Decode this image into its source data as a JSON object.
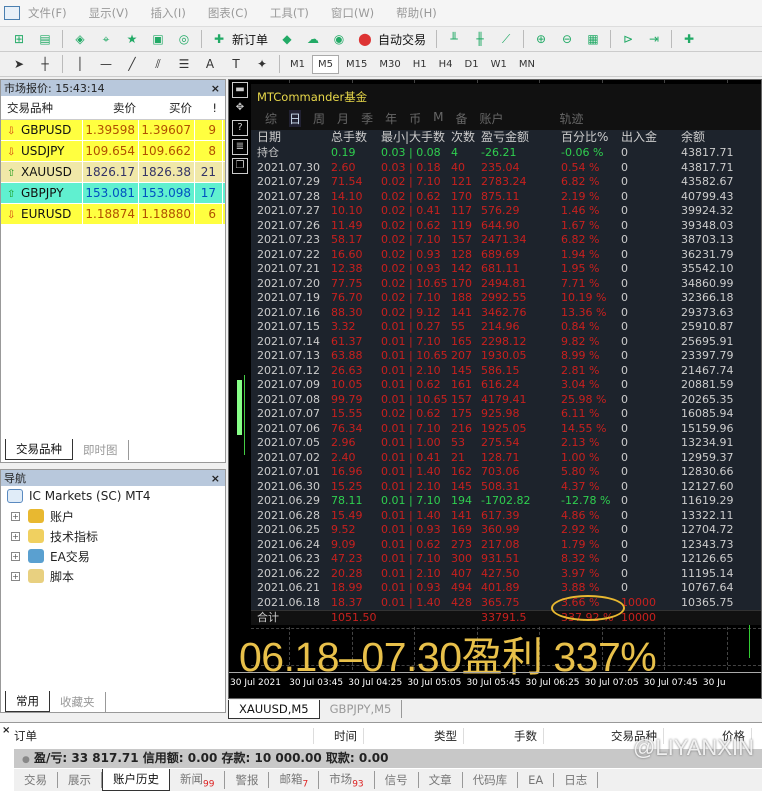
{
  "menu": [
    "文件(F)",
    "显示(V)",
    "插入(I)",
    "图表(C)",
    "工具(T)",
    "窗口(W)",
    "帮助(H)"
  ],
  "toolbar": {
    "new_order": "新订单",
    "auto_trade": "自动交易"
  },
  "timeframes": [
    "M1",
    "M5",
    "M15",
    "M30",
    "H1",
    "H4",
    "D1",
    "W1",
    "MN"
  ],
  "active_timeframe": "M5",
  "market_watch": {
    "title": "市场报价: 15:43:14",
    "headers": [
      "交易品种",
      "卖价",
      "买价",
      "!"
    ],
    "rows": [
      {
        "symbol": "GBPUSD",
        "bid": "1.39598",
        "ask": "1.39607",
        "spread": "9",
        "dir": "down",
        "bg": "#ffff40",
        "fg": "#b05000"
      },
      {
        "symbol": "USDJPY",
        "bid": "109.654",
        "ask": "109.662",
        "spread": "8",
        "dir": "down",
        "bg": "#ffff40",
        "fg": "#b05000"
      },
      {
        "symbol": "XAUUSD",
        "bid": "1826.17",
        "ask": "1826.38",
        "spread": "21",
        "dir": "up",
        "bg": "#f0e8a8",
        "fg": "#333366"
      },
      {
        "symbol": "GBPJPY",
        "bid": "153.081",
        "ask": "153.098",
        "spread": "17",
        "dir": "up",
        "bg": "#60f0d0",
        "fg": "#0050c0"
      },
      {
        "symbol": "EURUSD",
        "bid": "1.18874",
        "ask": "1.18880",
        "spread": "6",
        "dir": "down",
        "bg": "#ffff40",
        "fg": "#b05000"
      }
    ],
    "tabs": [
      "交易品种",
      "即时图"
    ]
  },
  "navigator": {
    "title": "导航",
    "root": "IC Markets (SC) MT4",
    "items": [
      "账户",
      "技术指标",
      "EA交易",
      "脚本"
    ],
    "tabs": [
      "常用",
      "收藏夹"
    ]
  },
  "commander": {
    "title": "MTCommander基金",
    "nav": [
      "综",
      "日",
      "周",
      "月",
      "季",
      "年",
      "币",
      "M",
      "备",
      "账户",
      "轨迹"
    ],
    "active": "日",
    "headers": [
      "日期",
      "总手数",
      "最小|大手数",
      "次数",
      "盈亏金额",
      "百分比%",
      "出入金",
      "余额"
    ],
    "rows": [
      [
        "持仓",
        "0.19",
        "0.03 | 0.08",
        "4",
        "-26.21",
        "-0.06 %",
        "0",
        "43817.71",
        "g"
      ],
      [
        "2021.07.30",
        "2.60",
        "0.03 | 0.18",
        "40",
        "235.04",
        "0.54 %",
        "0",
        "43817.71",
        "r"
      ],
      [
        "2021.07.29",
        "71.54",
        "0.02 | 7.10",
        "121",
        "2783.24",
        "6.82 %",
        "0",
        "43582.67",
        "r"
      ],
      [
        "2021.07.28",
        "14.10",
        "0.02 | 0.62",
        "170",
        "875.11",
        "2.19 %",
        "0",
        "40799.43",
        "r"
      ],
      [
        "2021.07.27",
        "10.10",
        "0.02 | 0.41",
        "117",
        "576.29",
        "1.46 %",
        "0",
        "39924.32",
        "r"
      ],
      [
        "2021.07.26",
        "11.49",
        "0.02 | 0.62",
        "119",
        "644.90",
        "1.67 %",
        "0",
        "39348.03",
        "r"
      ],
      [
        "2021.07.23",
        "58.17",
        "0.02 | 7.10",
        "157",
        "2471.34",
        "6.82 %",
        "0",
        "38703.13",
        "r"
      ],
      [
        "2021.07.22",
        "16.60",
        "0.02 | 0.93",
        "128",
        "689.69",
        "1.94 %",
        "0",
        "36231.79",
        "r"
      ],
      [
        "2021.07.21",
        "12.38",
        "0.02 | 0.93",
        "142",
        "681.11",
        "1.95 %",
        "0",
        "35542.10",
        "r"
      ],
      [
        "2021.07.20",
        "77.75",
        "0.02 | 10.65",
        "170",
        "2494.81",
        "7.71 %",
        "0",
        "34860.99",
        "r"
      ],
      [
        "2021.07.19",
        "76.70",
        "0.02 | 7.10",
        "188",
        "2992.55",
        "10.19 %",
        "0",
        "32366.18",
        "r"
      ],
      [
        "2021.07.16",
        "88.30",
        "0.02 | 9.12",
        "141",
        "3462.76",
        "13.36 %",
        "0",
        "29373.63",
        "r"
      ],
      [
        "2021.07.15",
        "3.32",
        "0.01 | 0.27",
        "55",
        "214.96",
        "0.84 %",
        "0",
        "25910.87",
        "r"
      ],
      [
        "2021.07.14",
        "61.37",
        "0.01 | 7.10",
        "165",
        "2298.12",
        "9.82 %",
        "0",
        "25695.91",
        "r"
      ],
      [
        "2021.07.13",
        "63.88",
        "0.01 | 10.65",
        "207",
        "1930.05",
        "8.99 %",
        "0",
        "23397.79",
        "r"
      ],
      [
        "2021.07.12",
        "26.63",
        "0.01 | 2.10",
        "145",
        "586.15",
        "2.81 %",
        "0",
        "21467.74",
        "r"
      ],
      [
        "2021.07.09",
        "10.05",
        "0.01 | 0.62",
        "161",
        "616.24",
        "3.04 %",
        "0",
        "20881.59",
        "r"
      ],
      [
        "2021.07.08",
        "99.79",
        "0.01 | 10.65",
        "157",
        "4179.41",
        "25.98 %",
        "0",
        "20265.35",
        "r"
      ],
      [
        "2021.07.07",
        "15.55",
        "0.02 | 0.62",
        "175",
        "925.98",
        "6.11 %",
        "0",
        "16085.94",
        "r"
      ],
      [
        "2021.07.06",
        "76.34",
        "0.01 | 7.10",
        "216",
        "1925.05",
        "14.55 %",
        "0",
        "15159.96",
        "r"
      ],
      [
        "2021.07.05",
        "2.96",
        "0.01 | 1.00",
        "53",
        "275.54",
        "2.13 %",
        "0",
        "13234.91",
        "r"
      ],
      [
        "2021.07.02",
        "2.40",
        "0.01 | 0.41",
        "21",
        "128.71",
        "1.00 %",
        "0",
        "12959.37",
        "r"
      ],
      [
        "2021.07.01",
        "16.96",
        "0.01 | 1.40",
        "162",
        "703.06",
        "5.80 %",
        "0",
        "12830.66",
        "r"
      ],
      [
        "2021.06.30",
        "15.25",
        "0.01 | 2.10",
        "145",
        "508.31",
        "4.37 %",
        "0",
        "12127.60",
        "r"
      ],
      [
        "2021.06.29",
        "78.11",
        "0.01 | 7.10",
        "194",
        "-1702.82",
        "-12.78 %",
        "0",
        "11619.29",
        "g"
      ],
      [
        "2021.06.28",
        "15.49",
        "0.01 | 1.40",
        "141",
        "617.39",
        "4.86 %",
        "0",
        "13322.11",
        "r"
      ],
      [
        "2021.06.25",
        "9.52",
        "0.01 | 0.93",
        "169",
        "360.99",
        "2.92 %",
        "0",
        "12704.72",
        "r"
      ],
      [
        "2021.06.24",
        "9.09",
        "0.01 | 0.62",
        "273",
        "217.08",
        "1.79 %",
        "0",
        "12343.73",
        "r"
      ],
      [
        "2021.06.23",
        "47.23",
        "0.01 | 7.10",
        "300",
        "931.51",
        "8.32 %",
        "0",
        "12126.65",
        "r"
      ],
      [
        "2021.06.22",
        "20.28",
        "0.01 | 2.10",
        "407",
        "427.50",
        "3.97 %",
        "0",
        "11195.14",
        "r"
      ],
      [
        "2021.06.21",
        "18.99",
        "0.01 | 0.93",
        "494",
        "401.89",
        "3.88 %",
        "0",
        "10767.64",
        "r"
      ],
      [
        "2021.06.18",
        "18.37",
        "0.01 | 1.40",
        "428",
        "365.75",
        "3.66 %",
        "10000",
        "10365.75",
        "r"
      ]
    ],
    "total": [
      "合计",
      "1051.50",
      "",
      "",
      "33791.5",
      "337.92 %",
      "10000",
      ""
    ]
  },
  "overlay_text": "06.18–07.30盈利 337%",
  "time_axis": [
    "30 Jul 2021",
    "30 Jul 03:45",
    "30 Jul 04:25",
    "30 Jul 05:05",
    "30 Jul 05:45",
    "30 Jul 06:25",
    "30 Jul 07:05",
    "30 Jul 07:45",
    "30 Ju"
  ],
  "chart_tabs": [
    "XAUUSD,M5",
    "GBPJPY,M5"
  ],
  "terminal": {
    "headers": [
      "订单",
      "时间",
      "类型",
      "手数",
      "交易品种",
      "价格"
    ],
    "summary": "盈/亏: 33 817.71  信用额: 0.00  存款: 10 000.00  取款: 0.00",
    "tabs": [
      {
        "label": "交易"
      },
      {
        "label": "展示"
      },
      {
        "label": "账户历史"
      },
      {
        "label": "新闻",
        "badge": "99"
      },
      {
        "label": "警报"
      },
      {
        "label": "邮箱",
        "badge": "7"
      },
      {
        "label": "市场",
        "badge": "93"
      },
      {
        "label": "信号"
      },
      {
        "label": "文章"
      },
      {
        "label": "代码库"
      },
      {
        "label": "EA"
      },
      {
        "label": "日志"
      }
    ],
    "active_tab": "账户历史"
  },
  "watermark": "@LIYANXIN"
}
